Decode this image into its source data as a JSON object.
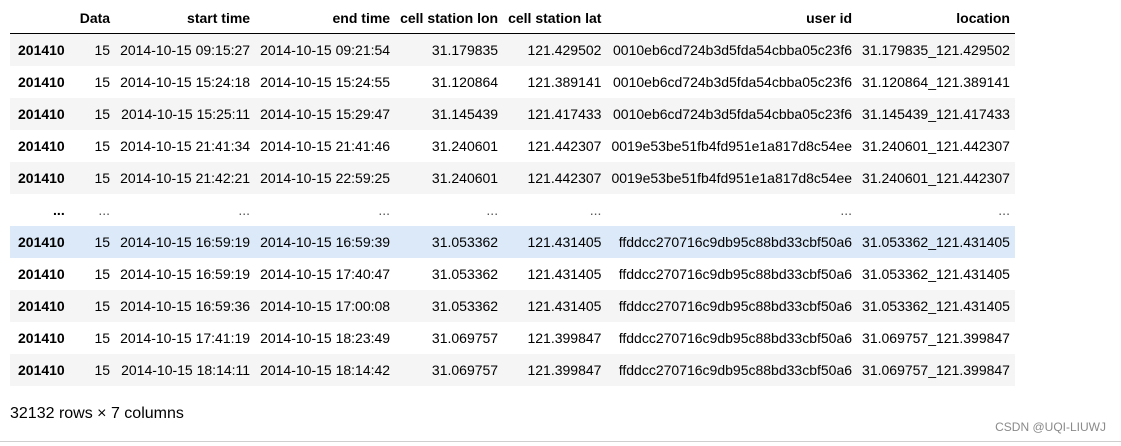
{
  "table": {
    "index_header": "",
    "columns": [
      "Data",
      "start time",
      "end time",
      "cell station lon",
      "cell station lat",
      "user id",
      "location"
    ],
    "rows": [
      {
        "index": "201410",
        "cells": [
          "15",
          "2014-10-15 09:15:27",
          "2014-10-15 09:21:54",
          "31.179835",
          "121.429502",
          "0010eb6cd724b3d5fda54cbba05c23f6",
          "31.179835_121.429502"
        ]
      },
      {
        "index": "201410",
        "cells": [
          "15",
          "2014-10-15 15:24:18",
          "2014-10-15 15:24:55",
          "31.120864",
          "121.389141",
          "0010eb6cd724b3d5fda54cbba05c23f6",
          "31.120864_121.389141"
        ]
      },
      {
        "index": "201410",
        "cells": [
          "15",
          "2014-10-15 15:25:11",
          "2014-10-15 15:29:47",
          "31.145439",
          "121.417433",
          "0010eb6cd724b3d5fda54cbba05c23f6",
          "31.145439_121.417433"
        ]
      },
      {
        "index": "201410",
        "cells": [
          "15",
          "2014-10-15 21:41:34",
          "2014-10-15 21:41:46",
          "31.240601",
          "121.442307",
          "0019e53be51fb4fd951e1a817d8c54ee",
          "31.240601_121.442307"
        ]
      },
      {
        "index": "201410",
        "cells": [
          "15",
          "2014-10-15 21:42:21",
          "2014-10-15 22:59:25",
          "31.240601",
          "121.442307",
          "0019e53be51fb4fd951e1a817d8c54ee",
          "31.240601_121.442307"
        ]
      },
      {
        "index": "...",
        "cells": [
          "...",
          "...",
          "...",
          "...",
          "...",
          "...",
          "..."
        ],
        "ellipsis": true
      },
      {
        "index": "201410",
        "cells": [
          "15",
          "2014-10-15 16:59:19",
          "2014-10-15 16:59:39",
          "31.053362",
          "121.431405",
          "ffddcc270716c9db95c88bd33cbf50a6",
          "31.053362_121.431405"
        ],
        "highlight": true
      },
      {
        "index": "201410",
        "cells": [
          "15",
          "2014-10-15 16:59:19",
          "2014-10-15 17:40:47",
          "31.053362",
          "121.431405",
          "ffddcc270716c9db95c88bd33cbf50a6",
          "31.053362_121.431405"
        ]
      },
      {
        "index": "201410",
        "cells": [
          "15",
          "2014-10-15 16:59:36",
          "2014-10-15 17:00:08",
          "31.053362",
          "121.431405",
          "ffddcc270716c9db95c88bd33cbf50a6",
          "31.053362_121.431405"
        ]
      },
      {
        "index": "201410",
        "cells": [
          "15",
          "2014-10-15 17:41:19",
          "2014-10-15 18:23:49",
          "31.069757",
          "121.399847",
          "ffddcc270716c9db95c88bd33cbf50a6",
          "31.069757_121.399847"
        ]
      },
      {
        "index": "201410",
        "cells": [
          "15",
          "2014-10-15 18:14:11",
          "2014-10-15 18:14:42",
          "31.069757",
          "121.399847",
          "ffddcc270716c9db95c88bd33cbf50a6",
          "31.069757_121.399847"
        ]
      }
    ]
  },
  "shape_note": "32132 rows × 7 columns",
  "watermark": "CSDN @UQI-LIUWJ",
  "colors": {
    "row_stripe": "#f5f5f5",
    "row_hover": "#dbe9f8",
    "watermark": "#8a8a8a"
  }
}
